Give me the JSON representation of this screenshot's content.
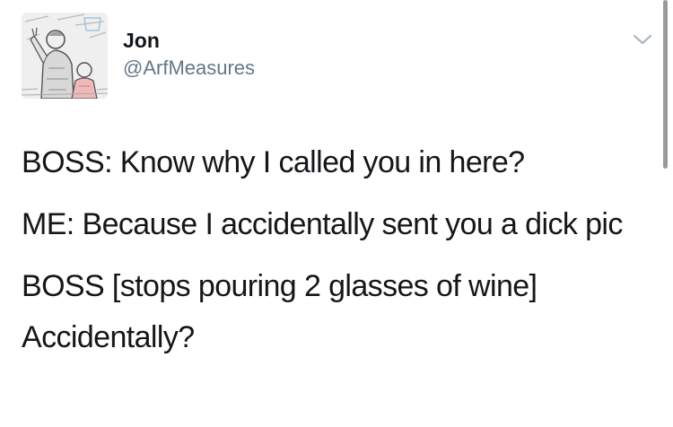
{
  "tweet": {
    "author": {
      "display_name": "Jon",
      "handle": "@ArfMeasures",
      "avatar_icon": "avatar-photo"
    },
    "menu_icon": "chevron-down-icon",
    "lines": [
      "BOSS: Know why I called you in here?",
      "ME: Because I accidentally sent you a dick pic",
      "BOSS [stops pouring 2 glasses of wine] Accidentally?"
    ]
  },
  "colors": {
    "text": "#14171a",
    "secondary_text": "#657786",
    "chevron": "#aab8c2",
    "scrollbar": "#9a9a9a"
  }
}
